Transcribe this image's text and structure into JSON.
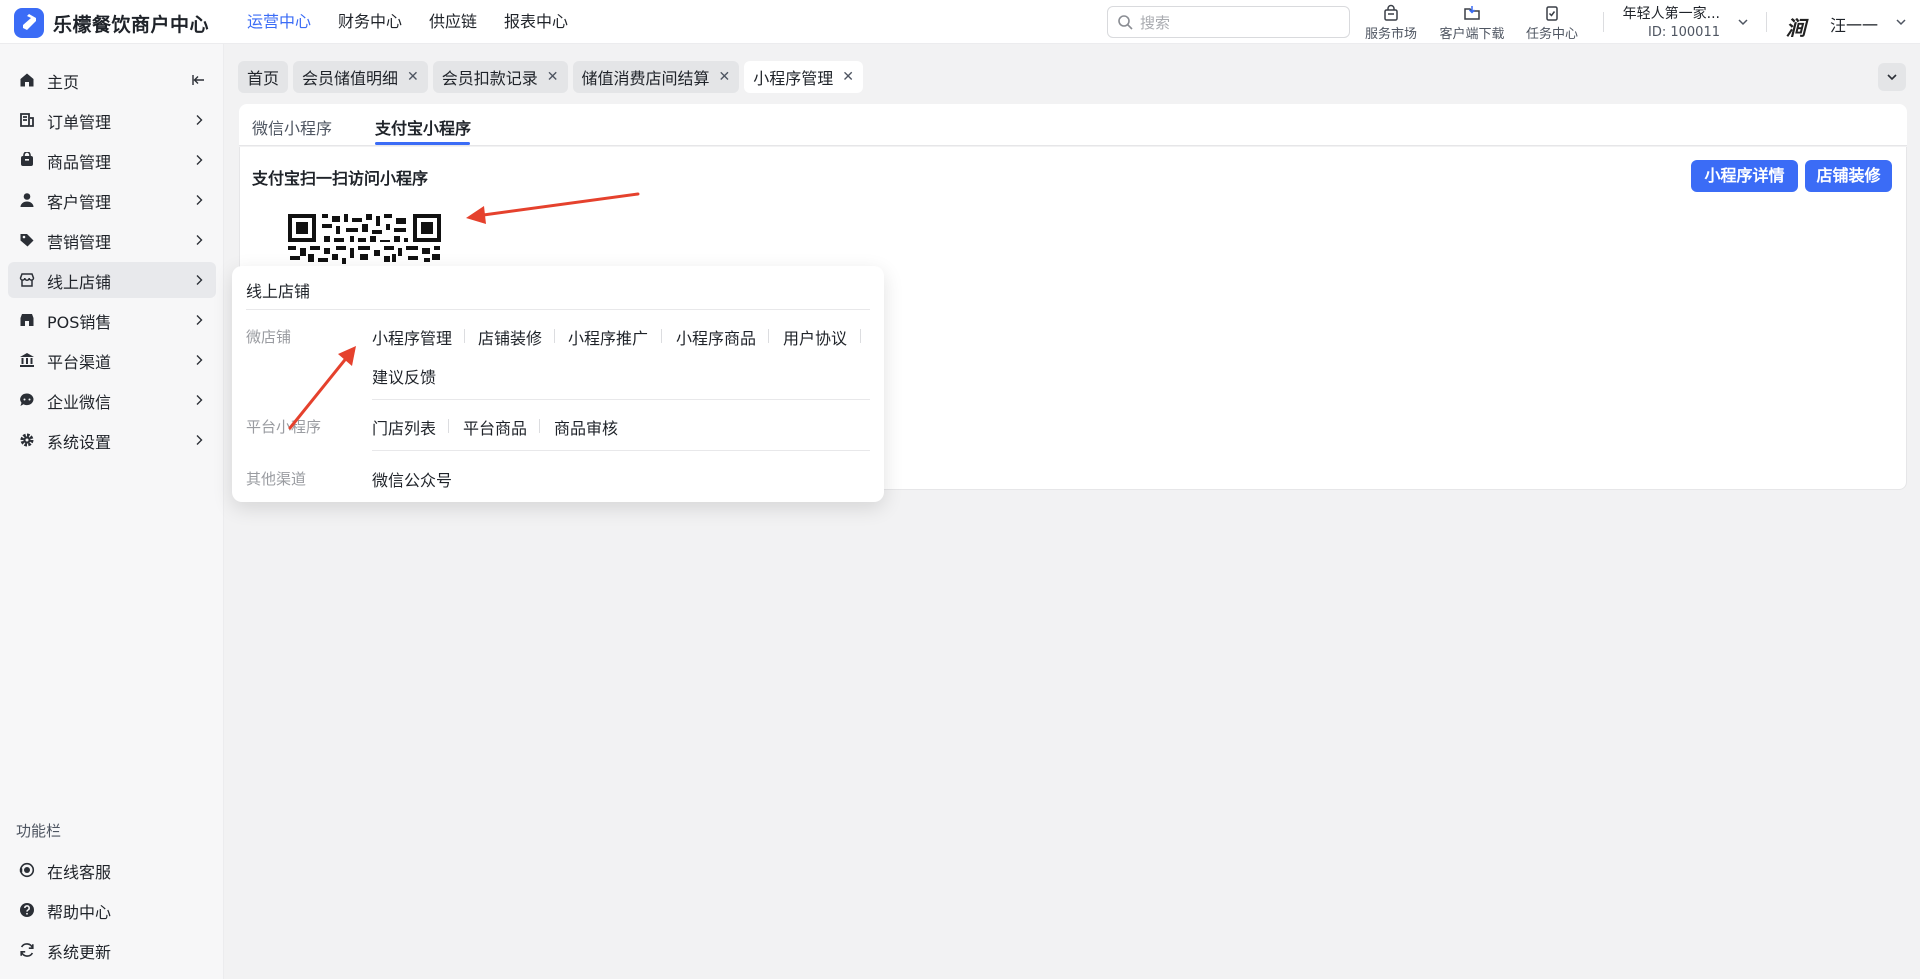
{
  "header": {
    "brand": "乐檬餐饮商户中心",
    "nav": [
      {
        "label": "运营中心",
        "active": true
      },
      {
        "label": "财务中心",
        "active": false
      },
      {
        "label": "供应链",
        "active": false
      },
      {
        "label": "报表中心",
        "active": false
      }
    ],
    "search_placeholder": "搜索",
    "tools": [
      "服务市场",
      "客户端下载",
      "任务中心"
    ],
    "shop_name": "年轻人第一家...",
    "shop_id": "ID: 100011",
    "avatar_text": "涧",
    "user_name": "汪一一"
  },
  "sidebar": {
    "items": [
      {
        "label": "主页",
        "icon": "home-icon"
      },
      {
        "label": "订单管理",
        "icon": "order-icon"
      },
      {
        "label": "商品管理",
        "icon": "product-icon"
      },
      {
        "label": "客户管理",
        "icon": "user-icon"
      },
      {
        "label": "营销管理",
        "icon": "tag-icon"
      },
      {
        "label": "线上店铺",
        "icon": "store-icon"
      },
      {
        "label": "POS销售",
        "icon": "pos-icon"
      },
      {
        "label": "平台渠道",
        "icon": "bank-icon"
      },
      {
        "label": "企业微信",
        "icon": "chat-icon"
      },
      {
        "label": "系统设置",
        "icon": "gear-icon"
      }
    ],
    "function_title": "功能栏",
    "function_items": [
      {
        "label": "在线客服",
        "icon": "headset-icon"
      },
      {
        "label": "帮助中心",
        "icon": "help-icon"
      },
      {
        "label": "系统更新",
        "icon": "refresh-icon"
      }
    ]
  },
  "tabs": [
    {
      "label": "首页",
      "closable": false,
      "active": false
    },
    {
      "label": "会员储值明细",
      "closable": true,
      "active": false
    },
    {
      "label": "会员扣款记录",
      "closable": true,
      "active": false
    },
    {
      "label": "储值消费店间结算",
      "closable": true,
      "active": false
    },
    {
      "label": "小程序管理",
      "closable": true,
      "active": true
    }
  ],
  "subtabs": [
    {
      "label": "微信小程序",
      "active": false
    },
    {
      "label": "支付宝小程序",
      "active": true
    }
  ],
  "card": {
    "title": "支付宝扫一扫访问小程序",
    "btn_detail": "小程序详情",
    "btn_decorate": "店铺装修"
  },
  "popover": {
    "title": "线上店铺",
    "groups": [
      {
        "category": "微店铺",
        "links": [
          "小程序管理",
          "店铺装修",
          "小程序推广",
          "小程序商品",
          "用户协议",
          "建议反馈"
        ]
      },
      {
        "category": "平台小程序",
        "links": [
          "门店列表",
          "平台商品",
          "商品审核"
        ]
      },
      {
        "category": "其他渠道",
        "links": [
          "微信公众号"
        ]
      }
    ]
  },
  "colors": {
    "accent": "#3b6cf6",
    "annotation_arrow": "#e5412d"
  }
}
